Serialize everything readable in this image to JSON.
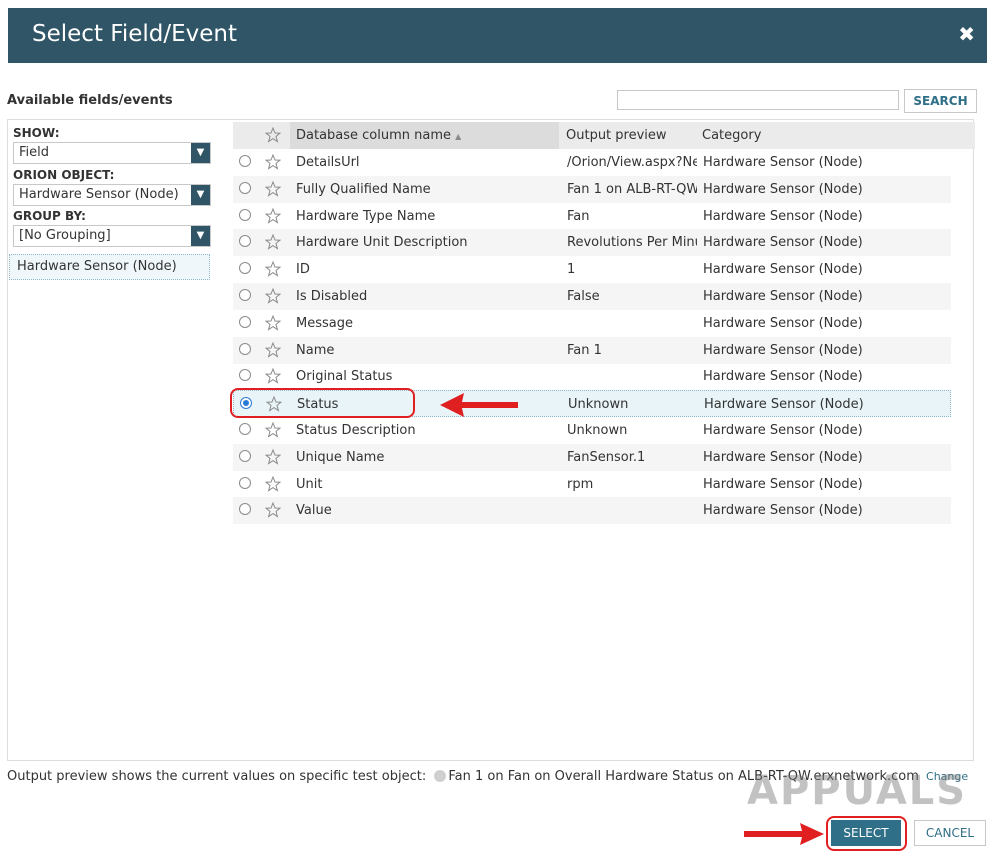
{
  "dialog": {
    "title": "Select Field/Event",
    "close_label": "✖"
  },
  "search": {
    "section_label": "Available fields/events",
    "placeholder": "",
    "value": "",
    "button_label": "SEARCH"
  },
  "filters": {
    "show_label": "SHOW:",
    "show_value": "Field",
    "orion_object_label": "ORION OBJECT:",
    "orion_object_value": "Hardware Sensor (Node)",
    "group_by_label": "GROUP BY:",
    "group_by_value": "[No Grouping]",
    "group_items": [
      "Hardware Sensor (Node)"
    ]
  },
  "table": {
    "columns": [
      "Database column name",
      "Output preview",
      "Category"
    ],
    "sort_indicator": "▲",
    "rows": [
      {
        "name": "DetailsUrl",
        "preview": "/Orion/View.aspx?Ne",
        "category": "Hardware Sensor (Node)",
        "selected": false
      },
      {
        "name": "Fully Qualified Name",
        "preview": "Fan 1 on ALB-RT-QW",
        "category": "Hardware Sensor (Node)",
        "selected": false
      },
      {
        "name": "Hardware Type Name",
        "preview": "Fan",
        "category": "Hardware Sensor (Node)",
        "selected": false
      },
      {
        "name": "Hardware Unit Description",
        "preview": "Revolutions Per Minu",
        "category": "Hardware Sensor (Node)",
        "selected": false
      },
      {
        "name": "ID",
        "preview": "1",
        "category": "Hardware Sensor (Node)",
        "selected": false
      },
      {
        "name": "Is Disabled",
        "preview": "False",
        "category": "Hardware Sensor (Node)",
        "selected": false
      },
      {
        "name": "Message",
        "preview": "",
        "category": "Hardware Sensor (Node)",
        "selected": false
      },
      {
        "name": "Name",
        "preview": "Fan 1",
        "category": "Hardware Sensor (Node)",
        "selected": false
      },
      {
        "name": "Original Status",
        "preview": "",
        "category": "Hardware Sensor (Node)",
        "selected": false
      },
      {
        "name": "Status",
        "preview": "Unknown",
        "category": "Hardware Sensor (Node)",
        "selected": true
      },
      {
        "name": "Status Description",
        "preview": "Unknown",
        "category": "Hardware Sensor (Node)",
        "selected": false
      },
      {
        "name": "Unique Name",
        "preview": "FanSensor.1",
        "category": "Hardware Sensor (Node)",
        "selected": false
      },
      {
        "name": "Unit",
        "preview": "rpm",
        "category": "Hardware Sensor (Node)",
        "selected": false
      },
      {
        "name": "Value",
        "preview": "",
        "category": "Hardware Sensor (Node)",
        "selected": false
      }
    ]
  },
  "footer": {
    "note": "Output preview shows the current values on specific test object:",
    "test_object": "Fan 1 on Fan on Overall Hardware Status on ALB-RT-QW.erxnetwork.com",
    "change_label": "Change",
    "select_label": "SELECT",
    "cancel_label": "CANCEL"
  },
  "watermark": "APPUALS",
  "colors": {
    "header_bg": "#2f5566",
    "accent": "#2f6f87",
    "highlight": "#e02020",
    "radio_on": "#2b7bd6"
  }
}
